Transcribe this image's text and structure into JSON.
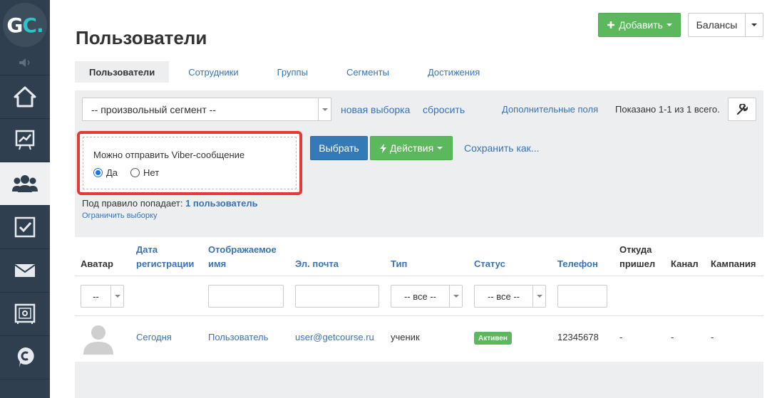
{
  "logo": {
    "g": "G",
    "c": "C",
    "dot": "."
  },
  "header": {
    "title": "Пользователи",
    "add_label": "Добавить",
    "balances_label": "Балансы"
  },
  "tabs": [
    "Пользователи",
    "Сотрудники",
    "Группы",
    "Сегменты",
    "Достижения"
  ],
  "filter": {
    "segment_value": "-- произвольный сегмент --",
    "new_selection": "новая выборка",
    "reset": "сбросить",
    "extra_fields": "Дополнительные поля",
    "shown_text": "Показано 1-1 из 1 всего.",
    "rule_title": "Можно отправить Viber-сообщение",
    "radio_yes": "Да",
    "radio_no": "Нет",
    "radio_selected": "Да",
    "choose_label": "Выбрать",
    "actions_label": "Действия",
    "save_as": "Сохранить как...",
    "rule_count_prefix": "Под правило попадает:",
    "rule_count_link": "1 пользователь",
    "limit_link": "Ограничить выборку"
  },
  "table": {
    "headers": {
      "avatar": "Аватар",
      "reg_date_1": "Дата",
      "reg_date_2": "регистрации",
      "display_name_1": "Отображаемое",
      "display_name_2": "имя",
      "email": "Эл. почта",
      "type": "Тип",
      "status": "Статус",
      "phone": "Телефон",
      "source_1": "Откуда",
      "source_2": "пришел",
      "channel": "Канал",
      "campaign": "Кампания"
    },
    "filters": {
      "avatar": "--",
      "type": "-- все --",
      "status": "-- все --"
    },
    "rows": [
      {
        "reg_date": "Сегодня",
        "name": "Пользователь",
        "email": "user@getcourse.ru",
        "type": "ученик",
        "status": "Активен",
        "phone": "12345678",
        "source": "-",
        "channel": "-",
        "campaign": "-"
      }
    ]
  },
  "colors": {
    "sidebar": "#2f3f4f",
    "accent_teal": "#2fc3c9",
    "green": "#5cb85c",
    "blue": "#337ab7",
    "link": "#3a72b8",
    "highlight": "#e53935"
  },
  "sidebar_icons": [
    "speaker-icon",
    "home-icon",
    "chart-icon",
    "users-icon",
    "checkbox-icon",
    "mail-icon",
    "safe-icon",
    "chat-c-icon"
  ]
}
